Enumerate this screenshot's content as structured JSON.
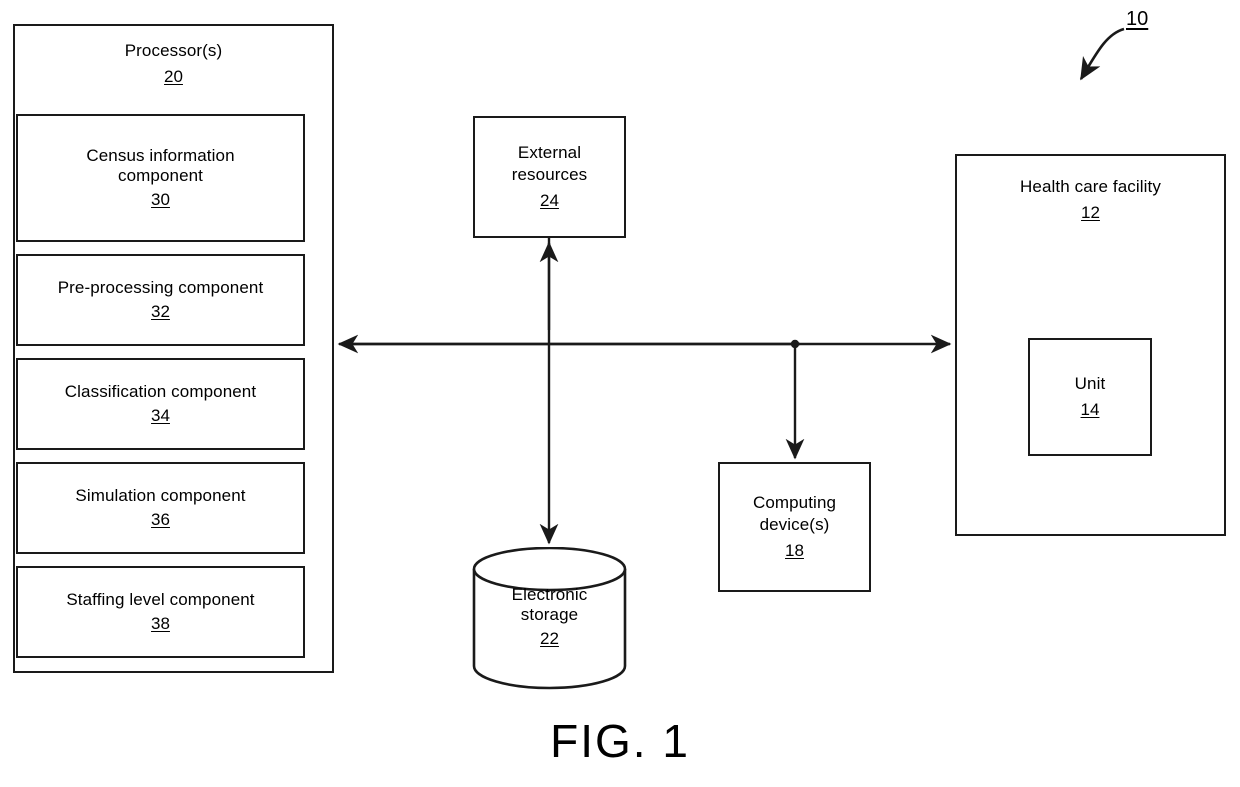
{
  "figure": {
    "caption": "FIG. 1",
    "system_callout": "10"
  },
  "processor": {
    "title": "Processor(s)",
    "ref": "20",
    "components": [
      {
        "label": "Census information\ncomponent",
        "ref": "30"
      },
      {
        "label": "Pre-processing component",
        "ref": "32"
      },
      {
        "label": "Classification component",
        "ref": "34"
      },
      {
        "label": "Simulation component",
        "ref": "36"
      },
      {
        "label": "Staffing level component",
        "ref": "38"
      }
    ]
  },
  "external_resources": {
    "label": "External\nresources",
    "ref": "24"
  },
  "electronic_storage": {
    "label": "Electronic\nstorage",
    "ref": "22"
  },
  "computing_device": {
    "label": "Computing\ndevice(s)",
    "ref": "18"
  },
  "healthcare_facility": {
    "label": "Health care facility",
    "ref": "12",
    "unit": {
      "label": "Unit",
      "ref": "14"
    }
  },
  "connectors": [
    {
      "name": "processor-to-facility-bus",
      "style": "double-arrow-horizontal"
    },
    {
      "name": "external-resources-to-storage",
      "style": "double-arrow-vertical"
    },
    {
      "name": "bus-to-computing-device",
      "style": "single-arrow-down"
    },
    {
      "name": "system-callout-arrow",
      "style": "curved-arrow"
    }
  ],
  "colors": {
    "line": "#1a1a1a",
    "background": "#ffffff",
    "text": "#000000"
  }
}
